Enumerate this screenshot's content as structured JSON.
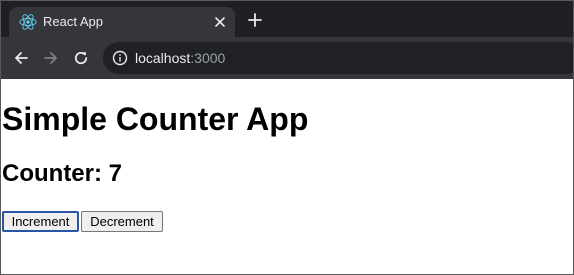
{
  "browser": {
    "tab": {
      "title": "React App",
      "favicon": "react-logo-icon"
    },
    "icons": {
      "close": "close-icon",
      "new_tab": "plus-icon",
      "back": "arrow-left-icon",
      "forward": "arrow-right-icon",
      "reload": "reload-icon",
      "site_info": "info-icon"
    },
    "address": {
      "host": "localhost",
      "port": ":3000"
    },
    "colors": {
      "tab_strip": "#1f2023",
      "active_tab": "#35363a",
      "omnibox": "#202124",
      "react_logo": "#61dafb"
    }
  },
  "page": {
    "title": "Simple Counter App",
    "counter_heading": "Counter: 7",
    "buttons": {
      "increment": "Increment",
      "decrement": "Decrement"
    }
  }
}
